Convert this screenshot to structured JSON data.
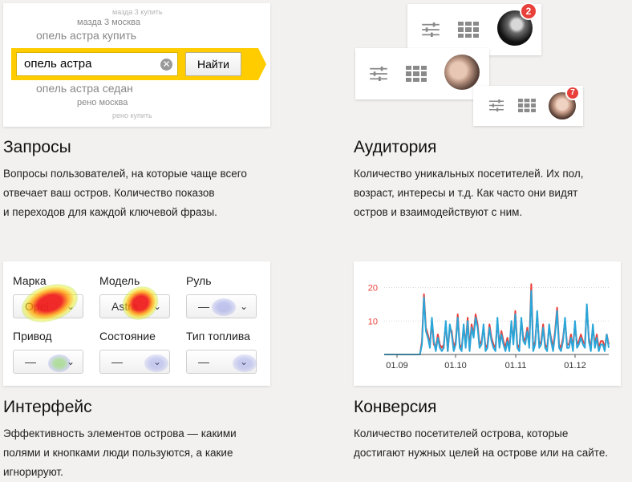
{
  "search_mock": {
    "suggestions_top": [
      "мазда 3 купить",
      "мазда 3 москва",
      "опель астра купить"
    ],
    "query": "опель астра",
    "button_label": "Найти",
    "clear_glyph": "✕",
    "suggestions_bottom": [
      "опель астра седан",
      "рено москва",
      "рено купить"
    ],
    "accent_color": "#ffcc00"
  },
  "audience_mock": {
    "badges": [
      "2",
      "7"
    ],
    "icons": [
      "sliders-icon",
      "grid-icon"
    ]
  },
  "interface_mock": {
    "fields": [
      {
        "label": "Марка",
        "value": "Opel"
      },
      {
        "label": "Модель",
        "value": "Astra"
      },
      {
        "label": "Руль",
        "value": "—"
      },
      {
        "label": "Привод",
        "value": "—"
      },
      {
        "label": "Состояние",
        "value": "—"
      },
      {
        "label": "Тип топлива",
        "value": "—"
      }
    ],
    "chevron": "⌄"
  },
  "chart_data": {
    "type": "line",
    "x_ticks": [
      "01.09",
      "01.10",
      "01.11",
      "01.12"
    ],
    "y_ticks": [
      "20",
      "10"
    ],
    "ylim": [
      0,
      23
    ],
    "series": [
      {
        "color": "#e8403a",
        "values": [
          0,
          0,
          0,
          0,
          0,
          0,
          0,
          0,
          0,
          0,
          0,
          0,
          0,
          0,
          0,
          0,
          0,
          0,
          0,
          4,
          18,
          8,
          6,
          3,
          10,
          3,
          2,
          6,
          3,
          2,
          3,
          9,
          1,
          8,
          7,
          2,
          4,
          12,
          3,
          2,
          8,
          3,
          11,
          2,
          9,
          6,
          12,
          9,
          3,
          4,
          8,
          2,
          3,
          9,
          5,
          3,
          2,
          10,
          3,
          7,
          4,
          2,
          5,
          2,
          9,
          4,
          13,
          3,
          2,
          10,
          5,
          4,
          8,
          3,
          21,
          2,
          4,
          12,
          3,
          4,
          9,
          3,
          2,
          8,
          5,
          2,
          7,
          14,
          3,
          2,
          5,
          10,
          3,
          3,
          6,
          2,
          9,
          3,
          4,
          6,
          4,
          3,
          14,
          5,
          2,
          8,
          3,
          6,
          2,
          4,
          4,
          2,
          6,
          3
        ]
      },
      {
        "color": "#2aa6d9",
        "values": [
          0,
          0,
          0,
          0,
          0,
          0,
          0,
          0,
          0,
          0,
          0,
          0,
          0,
          0,
          0,
          0,
          0,
          0,
          0,
          3,
          17,
          7,
          5,
          2,
          11,
          4,
          1,
          5,
          2,
          1,
          2,
          10,
          1,
          9,
          6,
          1,
          3,
          11,
          2,
          1,
          9,
          2,
          10,
          1,
          8,
          5,
          11,
          8,
          2,
          3,
          9,
          1,
          2,
          8,
          4,
          2,
          1,
          11,
          2,
          6,
          3,
          1,
          4,
          1,
          10,
          3,
          12,
          2,
          1,
          11,
          4,
          3,
          7,
          2,
          19,
          1,
          3,
          13,
          2,
          3,
          8,
          2,
          1,
          9,
          4,
          1,
          6,
          13,
          2,
          1,
          4,
          11,
          2,
          2,
          5,
          1,
          10,
          2,
          3,
          5,
          3,
          2,
          15,
          4,
          1,
          9,
          2,
          5,
          1,
          3,
          3,
          1,
          6,
          2
        ]
      }
    ]
  },
  "sections": [
    {
      "title": "Запросы",
      "lines": [
        "Вопросы пользователей, на которые чаще всего",
        "отвечает ваш остров. Количество показов",
        "и переходов для каждой ключевой фразы."
      ]
    },
    {
      "title": "Аудитория",
      "lines": [
        "Количество уникальных посетителей. Их пол,",
        "возраст, интересы и т.д. Как часто они видят",
        "остров и взаимодействуют с ним."
      ]
    },
    {
      "title": "Интерфейс",
      "lines": [
        "Эффективность элементов острова — какими",
        "полями и кнопками люди пользуются, а какие",
        "игнорируют."
      ]
    },
    {
      "title": "Конверсия",
      "lines": [
        "Количество посетителей острова, которые",
        "достигают нужных целей на острове или на сайте."
      ]
    }
  ]
}
